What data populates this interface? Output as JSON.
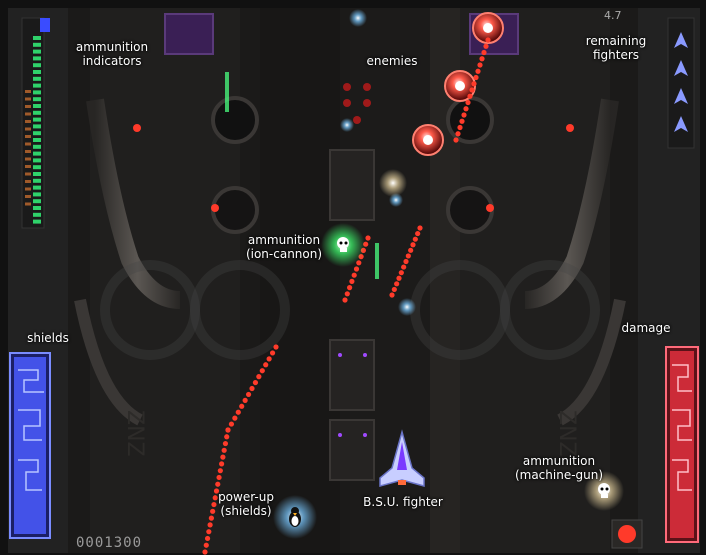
{
  "hud": {
    "score": "0001300",
    "version": "4.7",
    "remaining_fighters": 4,
    "shield_level": 1.0,
    "damage_level": 1.0
  },
  "labels": {
    "ammo_indicators": "ammunition\nindicators",
    "enemies": "enemies",
    "remaining_fighters": "remaining\nfighters",
    "ammo_ion_cannon": "ammunition\n(ion-cannon)",
    "shields": "shields",
    "damage": "damage",
    "ammo_machine_gun": "ammunition\n(machine-gun)",
    "powerup_shields": "power-up\n(shields)",
    "bsu_fighter": "B.S.U. fighter"
  },
  "colors": {
    "background": "#141414",
    "panel": "#2a2826",
    "enemy_shot": "#ff3b2a",
    "shield_bar": "#5a6cff",
    "damage_bar": "#ff3b4a",
    "ammo_bar": "#2fd26a",
    "ship": "#b9c4ff"
  },
  "icons": {
    "powerup": "penguin-icon",
    "ammo_ion": "skull-icon",
    "ammo_mg": "skull-icon",
    "fighter": "fighter-ship-icon",
    "enemy": "red-orb-enemy-icon"
  }
}
